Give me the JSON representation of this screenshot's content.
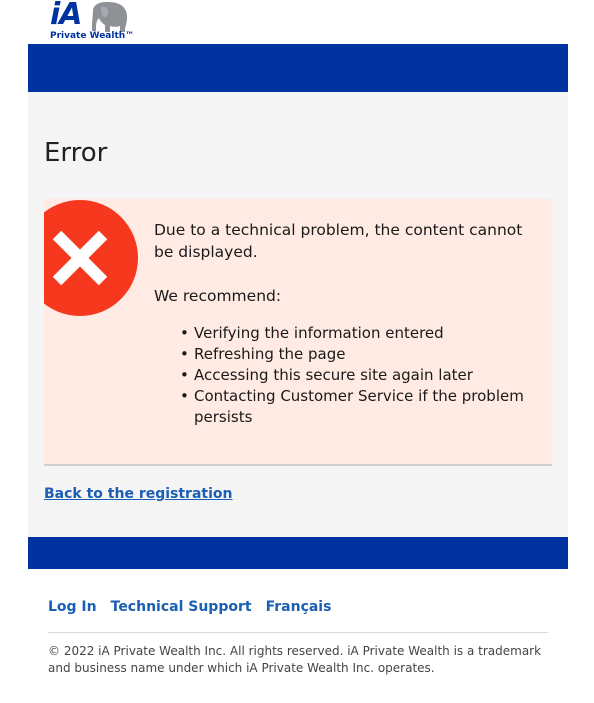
{
  "brand": {
    "logo_main": "iA",
    "logo_sub": "Private Wealth™",
    "primary_color": "#0033a0",
    "link_color": "#1a5fb4"
  },
  "page": {
    "title": "Error"
  },
  "error": {
    "icon": "error-x-icon",
    "icon_color": "#f5381e",
    "background": "#ffebe3",
    "message": "Due to a technical problem, the content cannot be displayed.",
    "recommend_heading": "We recommend:",
    "recommendations": [
      "Verifying the information entered",
      "Refreshing the page",
      "Accessing this secure site again later",
      "Contacting Customer Service if the problem persists"
    ]
  },
  "back_link": "Back to the registration",
  "footer": {
    "links": [
      "Log In",
      "Technical Support",
      "Français"
    ],
    "copyright": "© 2022 iA Private Wealth Inc. All rights reserved. iA Private Wealth is a trademark and business name under which iA Private Wealth Inc. operates."
  }
}
